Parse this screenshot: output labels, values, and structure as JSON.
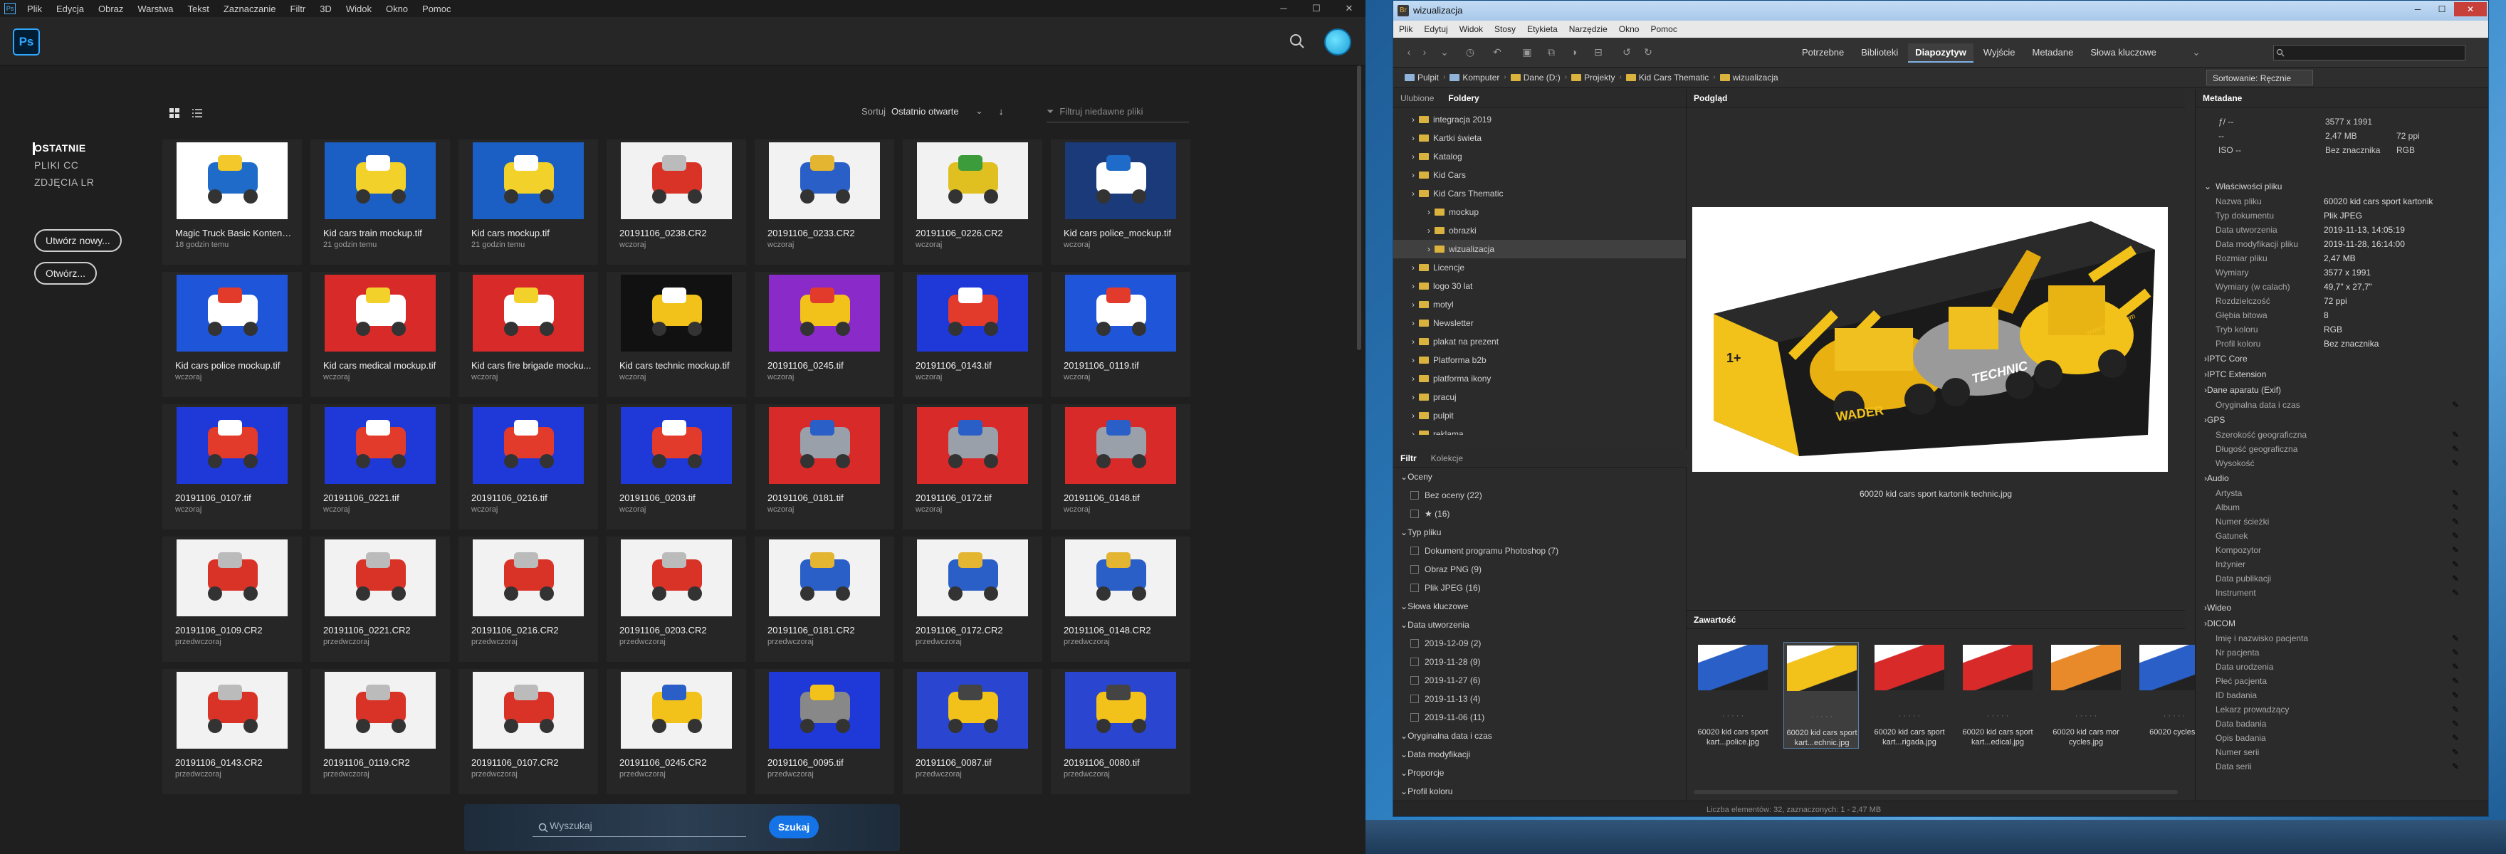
{
  "photoshop": {
    "menu": [
      "Plik",
      "Edycja",
      "Obraz",
      "Warstwa",
      "Tekst",
      "Zaznaczanie",
      "Filtr",
      "3D",
      "Widok",
      "Okno",
      "Pomoc"
    ],
    "logo": "Ps",
    "nav": [
      {
        "label": "OSTATNIE",
        "active": true
      },
      {
        "label": "PLIKI CC",
        "active": false
      },
      {
        "label": "ZDJĘCIA LR",
        "active": false
      }
    ],
    "new_button": "Utwórz nowy...",
    "open_button": "Otwórz...",
    "sort_label": "Sortuj",
    "sort_value": "Ostatnio otwarte",
    "filter_placeholder": "Filtruj niedawne pliki",
    "search_placeholder": "Wyszukaj",
    "search_button": "Szukaj",
    "files": [
      {
        "name": "Magic Truck Basic Konteneri...",
        "date": "18 godzin temu",
        "thumb": "box-blue"
      },
      {
        "name": "Kid cars train mockup.tif",
        "date": "21 godzin temu",
        "thumb": "blue-yellow"
      },
      {
        "name": "Kid cars mockup.tif",
        "date": "21 godzin temu",
        "thumb": "blue-yellow"
      },
      {
        "name": "20191106_0238.CR2",
        "date": "wczoraj",
        "thumb": "white-red"
      },
      {
        "name": "20191106_0233.CR2",
        "date": "wczoraj",
        "thumb": "white-blue"
      },
      {
        "name": "20191106_0226.CR2",
        "date": "wczoraj",
        "thumb": "white-green"
      },
      {
        "name": "Kid cars police_mockup.tif",
        "date": "wczoraj",
        "thumb": "dark-blue"
      },
      {
        "name": "Kid cars police mockup.tif",
        "date": "wczoraj",
        "thumb": "blue-white"
      },
      {
        "name": "Kid cars medical mockup.tif",
        "date": "wczoraj",
        "thumb": "red-white"
      },
      {
        "name": "Kid cars fire brigade mocku...",
        "date": "wczoraj",
        "thumb": "red-white"
      },
      {
        "name": "Kid cars technic mockup.tif",
        "date": "wczoraj",
        "thumb": "black-yellow"
      },
      {
        "name": "20191106_0245.tif",
        "date": "wczoraj",
        "thumb": "purple"
      },
      {
        "name": "20191106_0143.tif",
        "date": "wczoraj",
        "thumb": "blue-red"
      },
      {
        "name": "20191106_0119.tif",
        "date": "wczoraj",
        "thumb": "blue-white"
      },
      {
        "name": "20191106_0107.tif",
        "date": "wczoraj",
        "thumb": "blue-red"
      },
      {
        "name": "20191106_0221.tif",
        "date": "wczoraj",
        "thumb": "blue-red"
      },
      {
        "name": "20191106_0216.tif",
        "date": "wczoraj",
        "thumb": "blue-red"
      },
      {
        "name": "20191106_0203.tif",
        "date": "wczoraj",
        "thumb": "blue-red"
      },
      {
        "name": "20191106_0181.tif",
        "date": "wczoraj",
        "thumb": "red-grey"
      },
      {
        "name": "20191106_0172.tif",
        "date": "wczoraj",
        "thumb": "red-grey"
      },
      {
        "name": "20191106_0148.tif",
        "date": "wczoraj",
        "thumb": "red-grey"
      },
      {
        "name": "20191106_0109.CR2",
        "date": "przedwczoraj",
        "thumb": "white-red"
      },
      {
        "name": "20191106_0221.CR2",
        "date": "przedwczoraj",
        "thumb": "white-red"
      },
      {
        "name": "20191106_0216.CR2",
        "date": "przedwczoraj",
        "thumb": "white-red"
      },
      {
        "name": "20191106_0203.CR2",
        "date": "przedwczoraj",
        "thumb": "white-red"
      },
      {
        "name": "20191106_0181.CR2",
        "date": "przedwczoraj",
        "thumb": "white-blue"
      },
      {
        "name": "20191106_0172.CR2",
        "date": "przedwczoraj",
        "thumb": "white-blue"
      },
      {
        "name": "20191106_0148.CR2",
        "date": "przedwczoraj",
        "thumb": "white-blue"
      },
      {
        "name": "20191106_0143.CR2",
        "date": "przedwczoraj",
        "thumb": "white-red"
      },
      {
        "name": "20191106_0119.CR2",
        "date": "przedwczoraj",
        "thumb": "white-red"
      },
      {
        "name": "20191106_0107.CR2",
        "date": "przedwczoraj",
        "thumb": "white-red"
      },
      {
        "name": "20191106_0245.CR2",
        "date": "przedwczoraj",
        "thumb": "white-multi"
      },
      {
        "name": "20191106_0095.tif",
        "date": "przedwczoraj",
        "thumb": "blue-grey"
      },
      {
        "name": "20191106_0087.tif",
        "date": "przedwczoraj",
        "thumb": "blue-yellow2"
      },
      {
        "name": "20191106_0080.tif",
        "date": "przedwczoraj",
        "thumb": "blue-yellow2"
      }
    ]
  },
  "bridge": {
    "title": "wizualizacja",
    "menu": [
      "Plik",
      "Edytuj",
      "Widok",
      "Stosy",
      "Etykieta",
      "Narzędzie",
      "Okno",
      "Pomoc"
    ],
    "workspaces": [
      {
        "label": "Potrzebne",
        "active": false
      },
      {
        "label": "Biblioteki",
        "active": false
      },
      {
        "label": "Diapozytyw",
        "active": true
      },
      {
        "label": "Wyjście",
        "active": false
      },
      {
        "label": "Metadane",
        "active": false
      },
      {
        "label": "Słowa kluczowe",
        "active": false
      }
    ],
    "search_placeholder": "",
    "path": [
      "Pulpit",
      "Komputer",
      "Dane (D:)",
      "Projekty",
      "Kid Cars Thematic",
      "wizualizacja"
    ],
    "sort": "Sortowanie: Ręcznie",
    "tabs_left": [
      "Ulubione",
      "Foldery"
    ],
    "folders": [
      {
        "label": "integracja 2019",
        "indent": 1,
        "selected": false
      },
      {
        "label": "Kartki świeta",
        "indent": 1,
        "selected": false
      },
      {
        "label": "Katalog",
        "indent": 1,
        "selected": false
      },
      {
        "label": "Kid Cars",
        "indent": 1,
        "selected": false
      },
      {
        "label": "Kid Cars Thematic",
        "indent": 1,
        "selected": false
      },
      {
        "label": "mockup",
        "indent": 2,
        "selected": false
      },
      {
        "label": "obrazki",
        "indent": 2,
        "selected": false
      },
      {
        "label": "wizualizacja",
        "indent": 2,
        "selected": true
      },
      {
        "label": "Licencje",
        "indent": 1,
        "selected": false
      },
      {
        "label": "logo 30 lat",
        "indent": 1,
        "selected": false
      },
      {
        "label": "motyl",
        "indent": 1,
        "selected": false
      },
      {
        "label": "Newsletter",
        "indent": 1,
        "selected": false
      },
      {
        "label": "plakat na prezent",
        "indent": 1,
        "selected": false
      },
      {
        "label": "Platforma b2b",
        "indent": 1,
        "selected": false
      },
      {
        "label": "platforma ikony",
        "indent": 1,
        "selected": false
      },
      {
        "label": "pracuj",
        "indent": 1,
        "selected": false
      },
      {
        "label": "pulpit",
        "indent": 1,
        "selected": false
      },
      {
        "label": "reklama",
        "indent": 1,
        "selected": false
      }
    ],
    "tabs_filter": [
      "Filtr",
      "Kolekcje"
    ],
    "filters": [
      {
        "type": "section",
        "label": "Oceny"
      },
      {
        "type": "row",
        "label": "Bez oceny (22)"
      },
      {
        "type": "row",
        "label": "★ (16)"
      },
      {
        "type": "section",
        "label": "Typ pliku"
      },
      {
        "type": "row",
        "label": "Dokument programu Photoshop (7)"
      },
      {
        "type": "row",
        "label": "Obraz PNG (9)"
      },
      {
        "type": "row",
        "label": "Plik JPEG (16)"
      },
      {
        "type": "section",
        "label": "Słowa kluczowe"
      },
      {
        "type": "section",
        "label": "Data utworzenia"
      },
      {
        "type": "row",
        "label": "2019-12-09 (2)"
      },
      {
        "type": "row",
        "label": "2019-11-28 (9)"
      },
      {
        "type": "row",
        "label": "2019-11-27 (6)"
      },
      {
        "type": "row",
        "label": "2019-11-13 (4)"
      },
      {
        "type": "row",
        "label": "2019-11-06 (11)"
      },
      {
        "type": "section",
        "label": "Oryginalna data i czas"
      },
      {
        "type": "section",
        "label": "Data modyfikacji"
      },
      {
        "type": "section",
        "label": "Proporcje"
      },
      {
        "type": "section",
        "label": "Profil koloru"
      }
    ],
    "preview_tab": "Podgląd",
    "preview_caption": "60020 kid cars sport kartonik technic.jpg",
    "box_texts": {
      "brand": "WADER",
      "line": "TECHNIC",
      "badge": "1+",
      "url": "www.wader.com"
    },
    "content_tab": "Zawartość",
    "content_items": [
      {
        "label": "60020 kid cars sport kart...police.jpg",
        "thumb": "blue",
        "selected": false
      },
      {
        "label": "60020 kid cars sport kart...echnic.jpg",
        "thumb": "yellow",
        "selected": true
      },
      {
        "label": "60020 kid cars sport kart...rigada.jpg",
        "thumb": "red",
        "selected": false
      },
      {
        "label": "60020 kid cars sport kart...edical.jpg",
        "thumb": "red",
        "selected": false
      },
      {
        "label": "60020 kid cars mor cycles.jpg",
        "thumb": "multi",
        "selected": false
      },
      {
        "label": "60020 cycles.j",
        "thumb": "blue",
        "selected": false
      }
    ],
    "meta_tab": "Metadane",
    "meta_summary": {
      "f": "ƒ/ --",
      "res": "3577 x 1991",
      "size": "2,47 MB",
      "dpi": "72 ppi",
      "iso": "ISO --",
      "profile": "Bez znacznika",
      "mode": "RGB"
    },
    "file_props_title": "Właściwości pliku",
    "file_props": [
      {
        "k": "Nazwa pliku",
        "v": "60020 kid cars sport kartonik"
      },
      {
        "k": "Typ dokumentu",
        "v": "Plik JPEG"
      },
      {
        "k": "Data utworzenia",
        "v": "2019-11-13, 14:05:19"
      },
      {
        "k": "Data modyfikacji pliku",
        "v": "2019-11-28, 16:14:00"
      },
      {
        "k": "Rozmiar pliku",
        "v": "2,47 MB"
      },
      {
        "k": "Wymiary",
        "v": "3577 x 1991"
      },
      {
        "k": "Wymiary (w calach)",
        "v": "49,7\" x 27,7\""
      },
      {
        "k": "Rozdzielczość",
        "v": "72 ppi"
      },
      {
        "k": "Głębia bitowa",
        "v": "8"
      },
      {
        "k": "Tryb koloru",
        "v": "RGB"
      },
      {
        "k": "Profil koloru",
        "v": "Bez znacznika"
      }
    ],
    "meta_sections": [
      {
        "type": "section",
        "label": "IPTC Core"
      },
      {
        "type": "section",
        "label": "IPTC Extension"
      },
      {
        "type": "section",
        "label": "Dane aparatu (Exif)"
      },
      {
        "type": "field",
        "label": "Oryginalna data i czas"
      },
      {
        "type": "section",
        "label": "GPS"
      },
      {
        "type": "field",
        "label": "Szerokość geograficzna"
      },
      {
        "type": "field",
        "label": "Długość geograficzna"
      },
      {
        "type": "field",
        "label": "Wysokość"
      },
      {
        "type": "section",
        "label": "Audio"
      },
      {
        "type": "field",
        "label": "Artysta"
      },
      {
        "type": "field",
        "label": "Album"
      },
      {
        "type": "field",
        "label": "Numer ścieżki"
      },
      {
        "type": "field",
        "label": "Gatunek"
      },
      {
        "type": "field",
        "label": "Kompozytor"
      },
      {
        "type": "field",
        "label": "Inżynier"
      },
      {
        "type": "field",
        "label": "Data publikacji"
      },
      {
        "type": "field",
        "label": "Instrument"
      },
      {
        "type": "section",
        "label": "Wideo"
      },
      {
        "type": "section",
        "label": "DICOM"
      },
      {
        "type": "field",
        "label": "Imię i nazwisko pacjenta"
      },
      {
        "type": "field",
        "label": "Nr pacjenta"
      },
      {
        "type": "field",
        "label": "Data urodzenia"
      },
      {
        "type": "field",
        "label": "Płeć pacjenta"
      },
      {
        "type": "field",
        "label": "ID badania"
      },
      {
        "type": "field",
        "label": "Lekarz prowadzący"
      },
      {
        "type": "field",
        "label": "Data badania"
      },
      {
        "type": "field",
        "label": "Opis badania"
      },
      {
        "type": "field",
        "label": "Numer serii"
      },
      {
        "type": "field",
        "label": "Data serii"
      }
    ],
    "status": "Liczba elementów: 32, zaznaczonych: 1 - 2,47 MB"
  }
}
